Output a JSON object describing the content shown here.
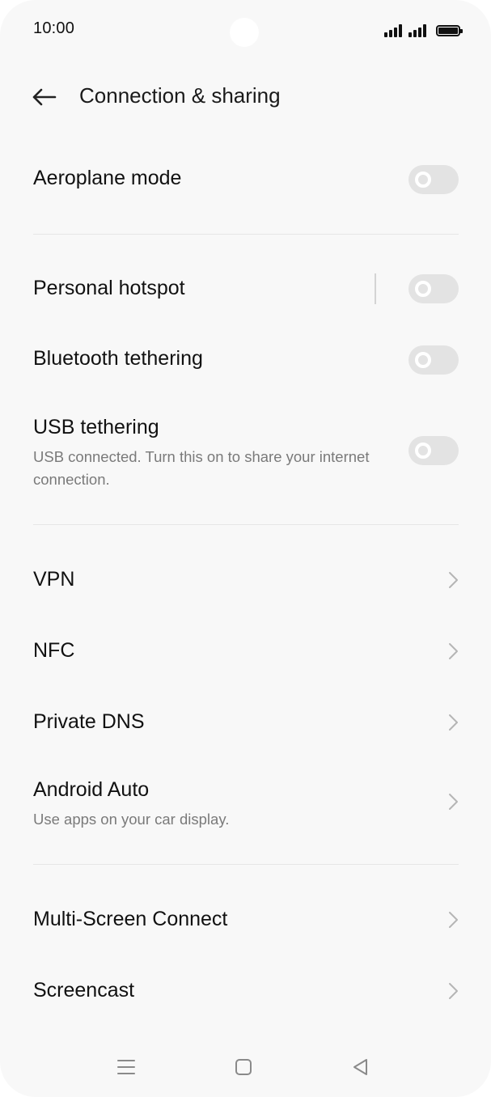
{
  "status_bar": {
    "time": "10:00"
  },
  "header": {
    "title": "Connection & sharing"
  },
  "settings": {
    "aeroplane": {
      "label": "Aeroplane mode",
      "enabled": false
    },
    "hotspot": {
      "label": "Personal hotspot",
      "enabled": false
    },
    "bt_tethering": {
      "label": "Bluetooth tethering",
      "enabled": false
    },
    "usb_tethering": {
      "label": "USB tethering",
      "description": "USB connected. Turn this on to share your internet connection.",
      "enabled": false
    },
    "vpn": {
      "label": "VPN"
    },
    "nfc": {
      "label": "NFC"
    },
    "private_dns": {
      "label": "Private DNS"
    },
    "android_auto": {
      "label": "Android Auto",
      "description": "Use apps on your car display."
    },
    "multi_screen": {
      "label": "Multi-Screen Connect"
    },
    "screencast": {
      "label": "Screencast"
    }
  },
  "colors": {
    "background": "#f8f8f8",
    "toggle_off": "#e3e3e3",
    "text_primary": "#111111",
    "text_secondary": "#7a7a7a"
  },
  "icons": {
    "back": "arrow-left-icon",
    "chevron": "chevron-right-icon",
    "nav_recents": "menu-lines-icon",
    "nav_home": "square-icon",
    "nav_back": "triangle-left-icon"
  }
}
